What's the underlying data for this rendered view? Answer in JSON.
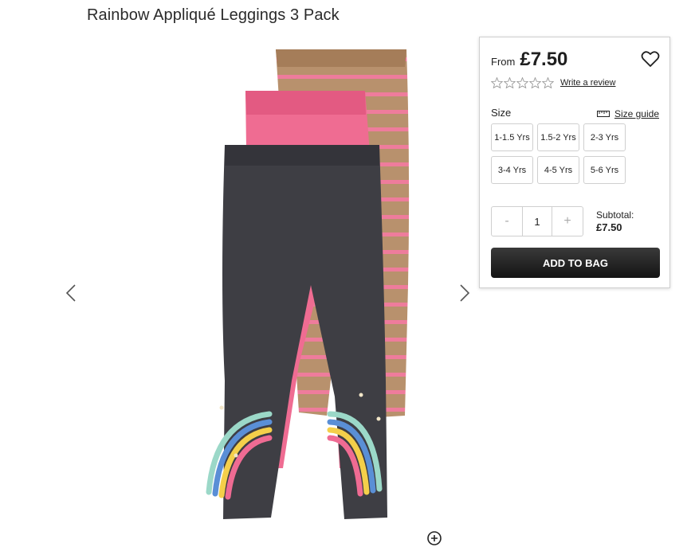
{
  "product": {
    "title": "Rainbow Appliqué Leggings 3 Pack",
    "from_label": "From",
    "price": "£7.50",
    "review_link": "Write a review",
    "star_rating": 0,
    "star_count": 5
  },
  "size": {
    "label": "Size",
    "guide_label": "Size guide",
    "options": [
      "1-1.5 Yrs",
      "1.5-2 Yrs",
      "2-3 Yrs",
      "3-4 Yrs",
      "4-5 Yrs",
      "5-6 Yrs"
    ]
  },
  "quantity": {
    "minus": "-",
    "value": "1",
    "plus": "+"
  },
  "subtotal": {
    "label": "Subtotal:",
    "amount": "£7.50"
  },
  "add_to_bag_label": "ADD TO BAG",
  "colors": {
    "charcoal": "#3e3e44",
    "pink": "#ef6b93",
    "tan": "#b58a65",
    "stripe": "#ee7a9a",
    "button": "#1f1f1f"
  }
}
